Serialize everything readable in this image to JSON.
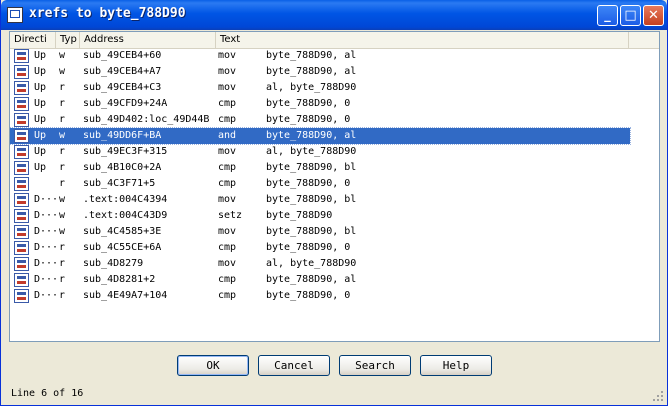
{
  "window": {
    "title": "xrefs to byte_788D90"
  },
  "columns": [
    {
      "key": "direction",
      "label": "Directi"
    },
    {
      "key": "type",
      "label": "Typ"
    },
    {
      "key": "address",
      "label": "Address"
    },
    {
      "key": "text",
      "label": "Text"
    }
  ],
  "rows": [
    {
      "direction": "Up",
      "type": "w",
      "address": "sub_49CEB4+60",
      "mnemonic": "mov",
      "operands": "byte_788D90, al",
      "selected": false
    },
    {
      "direction": "Up",
      "type": "w",
      "address": "sub_49CEB4+A7",
      "mnemonic": "mov",
      "operands": "byte_788D90, al",
      "selected": false
    },
    {
      "direction": "Up",
      "type": "r",
      "address": "sub_49CEB4+C3",
      "mnemonic": "mov",
      "operands": "al, byte_788D90",
      "selected": false
    },
    {
      "direction": "Up",
      "type": "r",
      "address": "sub_49CFD9+24A",
      "mnemonic": "cmp",
      "operands": "byte_788D90, 0",
      "selected": false
    },
    {
      "direction": "Up",
      "type": "r",
      "address": "sub_49D402:loc_49D44B",
      "mnemonic": "cmp",
      "operands": "byte_788D90, 0",
      "selected": false
    },
    {
      "direction": "Up",
      "type": "w",
      "address": "sub_49DD6F+BA",
      "mnemonic": "and",
      "operands": "byte_788D90, al",
      "selected": true
    },
    {
      "direction": "Up",
      "type": "r",
      "address": "sub_49EC3F+315",
      "mnemonic": "mov",
      "operands": "al, byte_788D90",
      "selected": false
    },
    {
      "direction": "Up",
      "type": "r",
      "address": "sub_4B10C0+2A",
      "mnemonic": "cmp",
      "operands": "byte_788D90, bl",
      "selected": false
    },
    {
      "direction": "",
      "type": "r",
      "address": "sub_4C3F71+5",
      "mnemonic": "cmp",
      "operands": "byte_788D90, 0",
      "selected": false
    },
    {
      "direction": "D···",
      "type": "w",
      "address": ".text:004C4394",
      "mnemonic": "mov",
      "operands": "byte_788D90, bl",
      "selected": false
    },
    {
      "direction": "D···",
      "type": "w",
      "address": ".text:004C43D9",
      "mnemonic": "setz",
      "operands": "byte_788D90",
      "selected": false
    },
    {
      "direction": "D···",
      "type": "w",
      "address": "sub_4C4585+3E",
      "mnemonic": "mov",
      "operands": "byte_788D90, bl",
      "selected": false
    },
    {
      "direction": "D···",
      "type": "r",
      "address": "sub_4C55CE+6A",
      "mnemonic": "cmp",
      "operands": "byte_788D90, 0",
      "selected": false
    },
    {
      "direction": "D···",
      "type": "r",
      "address": "sub_4D8279",
      "mnemonic": "mov",
      "operands": "al, byte_788D90",
      "selected": false
    },
    {
      "direction": "D···",
      "type": "r",
      "address": "sub_4D8281+2",
      "mnemonic": "cmp",
      "operands": "byte_788D90, al",
      "selected": false
    },
    {
      "direction": "D···",
      "type": "r",
      "address": "sub_4E49A7+104",
      "mnemonic": "cmp",
      "operands": "byte_788D90, 0",
      "selected": false
    }
  ],
  "buttons": {
    "ok": "OK",
    "cancel": "Cancel",
    "search": "Search",
    "help": "Help"
  },
  "status": {
    "text": "Line 6 of 16"
  },
  "icons": {
    "window": "xref-window-icon",
    "row": "xref-row-icon",
    "minimize": "minimize-icon",
    "maximize": "maximize-icon",
    "close": "close-icon"
  },
  "colors": {
    "titlebar": "#0055e5",
    "selection": "#316ac5",
    "window_bg": "#ece9d8"
  }
}
